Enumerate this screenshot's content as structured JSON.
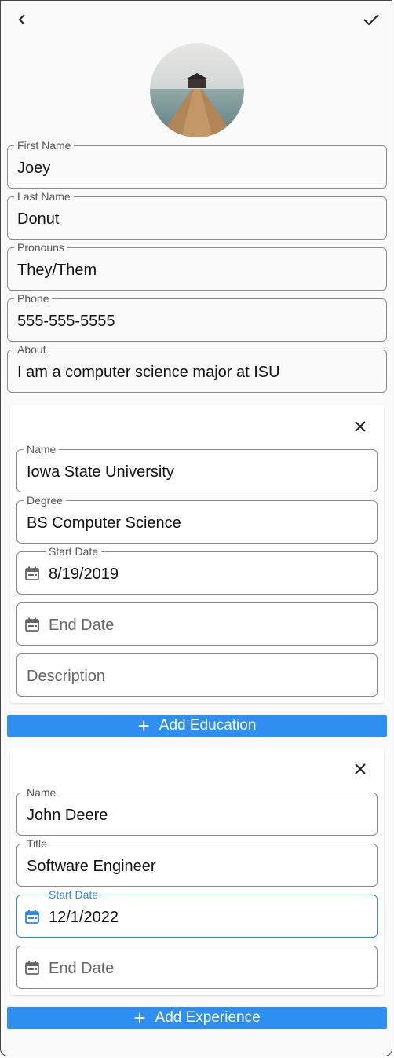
{
  "profile": {
    "first_name": {
      "label": "First Name",
      "value": "Joey"
    },
    "last_name": {
      "label": "Last Name",
      "value": "Donut"
    },
    "pronouns": {
      "label": "Pronouns",
      "value": "They/Them"
    },
    "phone": {
      "label": "Phone",
      "value": "555-555-5555"
    },
    "about": {
      "label": "About",
      "value": "I am a computer science major at ISU"
    }
  },
  "education": {
    "name": {
      "label": "Name",
      "value": "Iowa State University"
    },
    "degree": {
      "label": "Degree",
      "value": "BS Computer Science"
    },
    "start_date": {
      "label": "Start Date",
      "value": "8/19/2019"
    },
    "end_date": {
      "placeholder": "End Date"
    },
    "description": {
      "placeholder": "Description"
    },
    "add_label": "Add Education"
  },
  "experience": {
    "name": {
      "label": "Name",
      "value": "John Deere"
    },
    "title": {
      "label": "Title",
      "value": "Software Engineer"
    },
    "start_date": {
      "label": "Start Date",
      "value": "12/1/2022"
    },
    "end_date": {
      "placeholder": "End Date"
    },
    "add_label": "Add Experience"
  },
  "colors": {
    "accent": "#2f8ff0",
    "focus": "#2b8ae6"
  },
  "icons": [
    "back-arrow-icon",
    "check-icon",
    "close-icon",
    "calendar-icon",
    "plus-icon"
  ]
}
